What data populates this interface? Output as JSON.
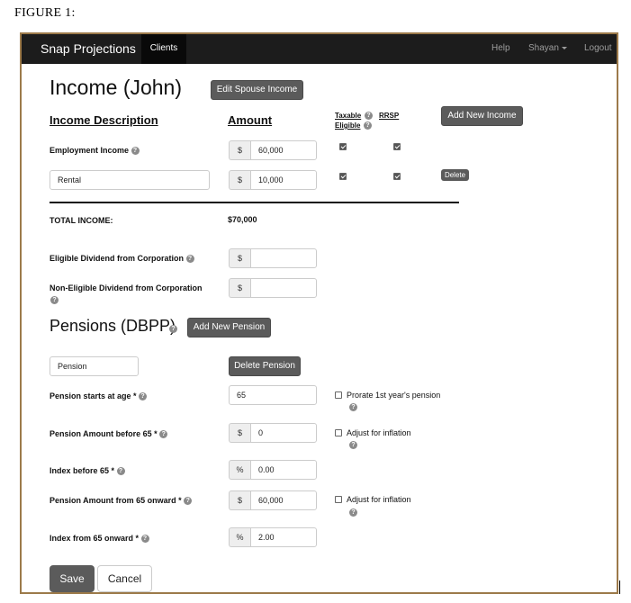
{
  "figure_caption": "FIGURE 1:",
  "nav": {
    "brand": "Snap Projections",
    "active_tab": "Clients",
    "help": "Help",
    "user": "Shayan",
    "logout": "Logout"
  },
  "income": {
    "title": "Income (John)",
    "edit_spouse_button": "Edit Spouse Income",
    "add_new_button": "Add New Income",
    "headers": {
      "description": "Income Description",
      "amount": "Amount",
      "taxable": "Taxable",
      "eligible": "Eligible",
      "rrsp": "RRSP"
    },
    "rows": [
      {
        "label": "Employment Income",
        "currency": "$",
        "amount": "60,000",
        "taxable": true,
        "rrsp": true
      },
      {
        "label": "Rental",
        "currency": "$",
        "amount": "10,000",
        "taxable": true,
        "rrsp": true,
        "delete_label": "Delete"
      }
    ],
    "total_label": "TOTAL INCOME:",
    "total_value": "$70,000",
    "eligible_dividend_label": "Eligible Dividend from Corporation",
    "eligible_dividend_currency": "$",
    "eligible_dividend_value": "",
    "non_eligible_dividend_label": "Non-Eligible Dividend from Corporation",
    "non_eligible_dividend_currency": "$",
    "non_eligible_dividend_value": ""
  },
  "pensions": {
    "title": "Pensions (DBPP)",
    "add_new_button": "Add New Pension",
    "name": "Pension",
    "delete_button": "Delete Pension",
    "starts_at_age_label": "Pension starts at age *",
    "starts_at_age": "65",
    "prorate_label": "Prorate 1st year's pension",
    "prorate_checked": false,
    "amount_before_65_label": "Pension Amount before 65 *",
    "amount_before_65_currency": "$",
    "amount_before_65": "0",
    "adjust_inflation_label_1": "Adjust for inflation",
    "adjust_inflation_1_checked": false,
    "index_before_65_label": "Index before 65 *",
    "index_before_65_unit": "%",
    "index_before_65": "0.00",
    "amount_from_65_label": "Pension Amount from 65 onward *",
    "amount_from_65_currency": "$",
    "amount_from_65": "60,000",
    "adjust_inflation_label_2": "Adjust for inflation",
    "adjust_inflation_2_checked": false,
    "index_from_65_label": "Index from 65 onward *",
    "index_from_65_unit": "%",
    "index_from_65": "2.00"
  },
  "actions": {
    "save": "Save",
    "cancel": "Cancel"
  },
  "icons": {
    "help": "question-circle-icon",
    "checkbox": "checkbox-icon",
    "caret": "caret-down-icon"
  },
  "colors": {
    "navbar": "#1c1c1c",
    "button": "#5b5b5b",
    "frame": "#9c7a4a"
  }
}
